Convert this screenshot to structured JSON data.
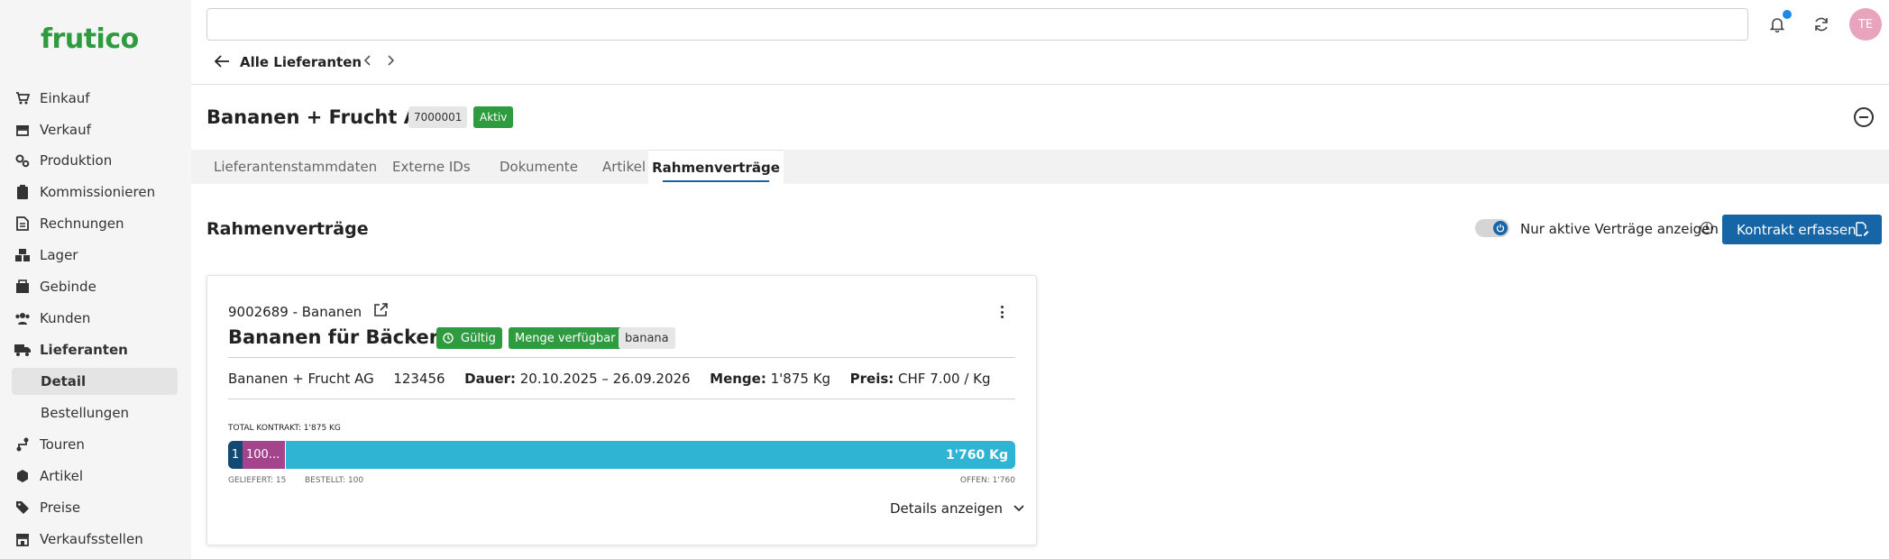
{
  "brand": {
    "name": "frutico",
    "color": "#2e9b3f"
  },
  "sidebar": {
    "items": [
      {
        "label": "Einkauf",
        "icon": "cart-icon"
      },
      {
        "label": "Verkauf",
        "icon": "storefront-icon"
      },
      {
        "label": "Produktion",
        "icon": "gears-icon"
      },
      {
        "label": "Kommissionieren",
        "icon": "clipboard-icon"
      },
      {
        "label": "Rechnungen",
        "icon": "invoice-icon"
      },
      {
        "label": "Lager",
        "icon": "boxes-icon"
      },
      {
        "label": "Gebinde",
        "icon": "crate-icon"
      },
      {
        "label": "Kunden",
        "icon": "people-icon"
      },
      {
        "label": "Lieferanten",
        "icon": "truck-icon"
      },
      {
        "label": "Touren",
        "icon": "route-icon"
      },
      {
        "label": "Artikel",
        "icon": "hexagon-icon"
      },
      {
        "label": "Preise",
        "icon": "tags-icon"
      },
      {
        "label": "Verkaufsstellen",
        "icon": "shop-icon"
      }
    ],
    "sub_items": [
      {
        "label": "Detail",
        "active": true
      },
      {
        "label": "Bestellungen",
        "active": false
      }
    ]
  },
  "topbar": {
    "search_placeholder": "",
    "avatar_initials": "TE",
    "avatar_color": "#e8a3bd"
  },
  "nav": {
    "back_label": "Alle Lieferanten"
  },
  "supplier": {
    "name": "Bananen + Frucht AG",
    "number": "7000001",
    "status": "Aktiv"
  },
  "tabs": [
    {
      "label": "Lieferantenstammdaten",
      "active": false
    },
    {
      "label": "Externe IDs",
      "active": false
    },
    {
      "label": "Dokumente",
      "active": false
    },
    {
      "label": "Artikel",
      "active": false
    },
    {
      "label": "Rahmenverträge",
      "active": true
    }
  ],
  "section": {
    "title": "Rahmenverträge",
    "toggle_label": "Nur aktive Verträge anzeigen",
    "toggle_on": true,
    "create_button": "Kontrakt erfassen",
    "accent_color": "#1565a7"
  },
  "contract": {
    "reference": "9002689 - Bananen",
    "title": "Bananen für Bäckerei",
    "badges": [
      "Gültig",
      "Menge verfügbar",
      "banana"
    ],
    "supplier": "Bananen + Frucht AG",
    "supplier_ref": "123456",
    "duration_label": "Dauer:",
    "duration_value": "20.10.2025 – 26.09.2026",
    "quantity_label": "Menge:",
    "quantity_value": "1'875 Kg",
    "price_label": "Preis:",
    "price_value": "CHF 7.00 / Kg",
    "total_label": "TOTAL KONTRAKT: 1'875 KG",
    "progress": {
      "total": 1875,
      "delivered": 15,
      "ordered": 100,
      "open": 1760,
      "delivered_text": "1",
      "ordered_text": "100...",
      "open_text": "1'760 Kg",
      "delivered_label": "GELIEFERT: 15",
      "ordered_label": "BESTELLT: 100",
      "open_label": "OFFEN: 1'760",
      "colors": {
        "delivered": "#124a72",
        "ordered": "#a4448c",
        "open": "#2fb4d3"
      }
    },
    "details_label": "Details anzeigen"
  }
}
